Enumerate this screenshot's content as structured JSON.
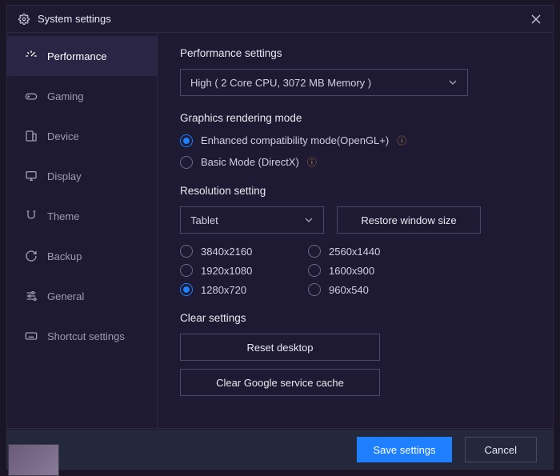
{
  "window": {
    "title": "System settings"
  },
  "sidebar": {
    "items": [
      {
        "label": "Performance",
        "icon": "speed"
      },
      {
        "label": "Gaming",
        "icon": "gaming"
      },
      {
        "label": "Device",
        "icon": "device"
      },
      {
        "label": "Display",
        "icon": "display"
      },
      {
        "label": "Theme",
        "icon": "theme"
      },
      {
        "label": "Backup",
        "icon": "backup"
      },
      {
        "label": "General",
        "icon": "general"
      },
      {
        "label": "Shortcut settings",
        "icon": "keyboard"
      }
    ]
  },
  "performance": {
    "title": "Performance settings",
    "selected": "High ( 2 Core CPU, 3072 MB Memory )"
  },
  "graphics": {
    "title": "Graphics rendering mode",
    "options": [
      {
        "label": "Enhanced compatibility mode(OpenGL+)",
        "checked": true,
        "info": true
      },
      {
        "label": "Basic Mode (DirectX)",
        "checked": false,
        "info": true
      }
    ]
  },
  "resolution": {
    "title": "Resolution setting",
    "mode": "Tablet",
    "restore_label": "Restore window size",
    "options": [
      {
        "label": "3840x2160",
        "checked": false
      },
      {
        "label": "2560x1440",
        "checked": false
      },
      {
        "label": "1920x1080",
        "checked": false
      },
      {
        "label": "1600x900",
        "checked": false
      },
      {
        "label": "1280x720",
        "checked": true
      },
      {
        "label": "960x540",
        "checked": false
      }
    ]
  },
  "clear": {
    "title": "Clear settings",
    "reset_label": "Reset desktop",
    "cache_label": "Clear Google service cache"
  },
  "footer": {
    "save": "Save settings",
    "cancel": "Cancel"
  }
}
